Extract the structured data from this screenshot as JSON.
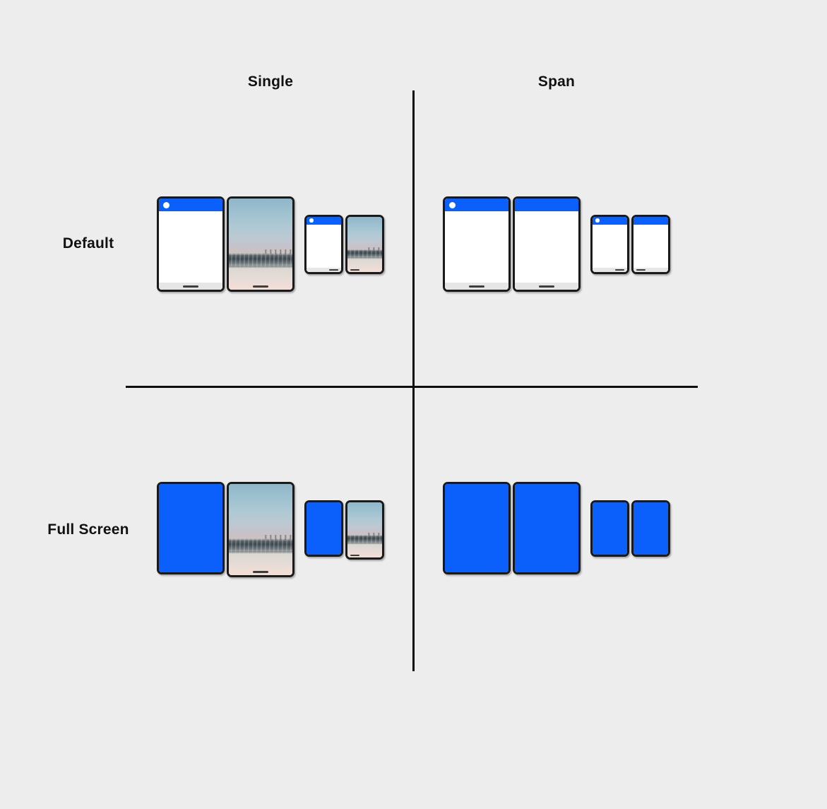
{
  "background_color": "#ededed",
  "accent_color": "#0b5ffb",
  "line_color": "#0d0d0d",
  "matrix": {
    "columns": [
      {
        "key": "single",
        "label": "Single"
      },
      {
        "key": "span",
        "label": "Span"
      }
    ],
    "rows": [
      {
        "key": "default",
        "label": "Default"
      },
      {
        "key": "fullscreen",
        "label": "Full Screen"
      }
    ]
  },
  "cells": {
    "single_default": {
      "description": "App on one screen with title bar, wallpaper on other screen",
      "large_device": {
        "left_screen": {
          "content": "app",
          "chrome": "title-bar",
          "nav_bar": true
        },
        "right_screen": {
          "content": "wallpaper",
          "nav_bar": true
        }
      },
      "small_device": {
        "left_screen": {
          "content": "app",
          "chrome": "title-bar",
          "nav_bar": true
        },
        "right_screen": {
          "content": "wallpaper",
          "nav_bar": true
        }
      }
    },
    "span_default": {
      "description": "App spanned across both screens with title bar",
      "large_device": {
        "left_screen": {
          "content": "app",
          "chrome": "title-bar",
          "nav_bar": true
        },
        "right_screen": {
          "content": "app",
          "chrome": "title-bar",
          "nav_bar": true
        }
      },
      "small_device": {
        "left_screen": {
          "content": "app",
          "chrome": "title-bar",
          "nav_bar": true
        },
        "right_screen": {
          "content": "app",
          "chrome": "title-bar",
          "nav_bar": true
        }
      }
    },
    "single_fullscreen": {
      "description": "App full screen on one screen, wallpaper on other screen",
      "large_device": {
        "left_screen": {
          "content": "app-fullscreen",
          "chrome": "none",
          "nav_bar": false
        },
        "right_screen": {
          "content": "wallpaper",
          "nav_bar": true
        }
      },
      "small_device": {
        "left_screen": {
          "content": "app-fullscreen",
          "chrome": "none",
          "nav_bar": false
        },
        "right_screen": {
          "content": "wallpaper",
          "nav_bar": true
        }
      }
    },
    "span_fullscreen": {
      "description": "App full screen spanned across both screens",
      "large_device": {
        "left_screen": {
          "content": "app-fullscreen",
          "chrome": "none",
          "nav_bar": false
        },
        "right_screen": {
          "content": "app-fullscreen",
          "chrome": "none",
          "nav_bar": false
        }
      },
      "small_device": {
        "left_screen": {
          "content": "app-fullscreen",
          "chrome": "none",
          "nav_bar": false
        },
        "right_screen": {
          "content": "app-fullscreen",
          "chrome": "none",
          "nav_bar": false
        }
      }
    }
  }
}
